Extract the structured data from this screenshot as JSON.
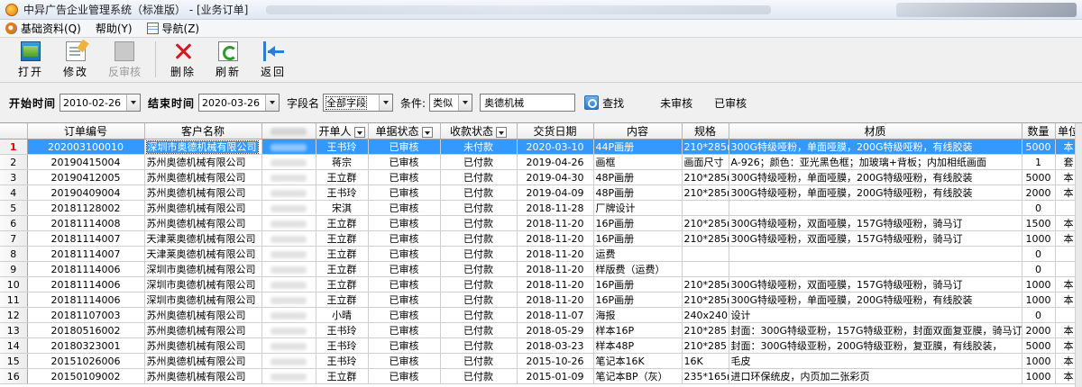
{
  "window": {
    "title": "中异广告企业管理系统（标准版） - [业务订单]"
  },
  "menu": [
    {
      "label": "基础资料(Q)",
      "icon": "base-data-icon"
    },
    {
      "label": "帮助(Y)",
      "icon": ""
    },
    {
      "label": "导航(Z)",
      "icon": "nav-icon"
    }
  ],
  "toolbar": {
    "open": "打开",
    "edit": "修改",
    "unreview": "反审核",
    "delete": "删除",
    "refresh": "刷新",
    "back": "返回"
  },
  "filter": {
    "start_label": "开始时间",
    "start_value": "2010-02-26",
    "end_label": "结束时间",
    "end_value": "2020-03-26",
    "field_label": "字段名",
    "field_value": "全部字段",
    "cond_label": "条件:",
    "cond_value": "类似",
    "keyword": "奥德机械",
    "search_label": "查找",
    "unreviewed_label": "未审核",
    "reviewed_label": "已审核"
  },
  "grid": {
    "columns": [
      "订单编号",
      "客户名称",
      "",
      "开单人",
      "单据状态",
      "收款状态",
      "交货日期",
      "内容",
      "规格",
      "材质",
      "数量",
      "单位"
    ],
    "selected_row": 0,
    "rows": [
      {
        "n": "1",
        "id": "202003100010",
        "cust": "深圳市奥德机械有限公司",
        "by": "王书玲",
        "status": "已审核",
        "pay": "未付款",
        "date": "2020-03-10",
        "content": "44P画册",
        "spec": "210*285mi",
        "mat": "300G特级哑粉，单面哑膜，200G特级哑粉，有线胶装",
        "qty": "5000",
        "unit": "本"
      },
      {
        "n": "2",
        "id": "20190415004",
        "cust": "苏州奥德机械有限公司",
        "by": "蒋宗",
        "status": "已审核",
        "pay": "已付款",
        "date": "2019-04-26",
        "content": "画框",
        "spec": "画面尺寸",
        "mat": "A-926；颜色：亚光黑色框；加玻璃+背板；内加相纸画面",
        "qty": "1",
        "unit": "套"
      },
      {
        "n": "3",
        "id": "20190412005",
        "cust": "苏州奥德机械有限公司",
        "by": "王立群",
        "status": "已审核",
        "pay": "已付款",
        "date": "2019-04-30",
        "content": "48P画册",
        "spec": "210*285mi",
        "mat": "300G特级哑粉，单面哑膜，200G特级哑粉，有线胶装",
        "qty": "5000",
        "unit": "本"
      },
      {
        "n": "4",
        "id": "20190409004",
        "cust": "苏州奥德机械有限公司",
        "by": "王书玲",
        "status": "已审核",
        "pay": "已付款",
        "date": "2019-04-09",
        "content": "48P画册",
        "spec": "210*285mi",
        "mat": "300G特级哑粉，单面哑膜，200G特级哑粉，有线胶装",
        "qty": "2000",
        "unit": "本"
      },
      {
        "n": "5",
        "id": "20181128002",
        "cust": "苏州奥德机械有限公司",
        "by": "宋淇",
        "status": "已审核",
        "pay": "已付款",
        "date": "2018-11-28",
        "content": "厂牌设计",
        "spec": "",
        "mat": "",
        "qty": "0",
        "unit": ""
      },
      {
        "n": "6",
        "id": "20181114008",
        "cust": "苏州奥德机械有限公司",
        "by": "王立群",
        "status": "已审核",
        "pay": "已付款",
        "date": "2018-11-20",
        "content": "16P画册",
        "spec": "210*285mi",
        "mat": "300G特级哑粉，双面哑膜，157G特级哑粉，骑马订",
        "qty": "1500",
        "unit": "本"
      },
      {
        "n": "7",
        "id": "20181114007",
        "cust": "天津莱奥德机械有限公司",
        "by": "王立群",
        "status": "已审核",
        "pay": "已付款",
        "date": "2018-11-20",
        "content": "16P画册",
        "spec": "210*285mi",
        "mat": "300G特级哑粉，双面哑膜，157G特级哑粉，骑马订",
        "qty": "1000",
        "unit": "本"
      },
      {
        "n": "8",
        "id": "20181114007",
        "cust": "天津莱奥德机械有限公司",
        "by": "王立群",
        "status": "已审核",
        "pay": "已付款",
        "date": "2018-11-20",
        "content": "运费",
        "spec": "",
        "mat": "",
        "qty": "0",
        "unit": ""
      },
      {
        "n": "9",
        "id": "20181114006",
        "cust": "深圳市奥德机械有限公司",
        "by": "王立群",
        "status": "已审核",
        "pay": "已付款",
        "date": "2018-11-20",
        "content": "样版费（运费）",
        "spec": "",
        "mat": "",
        "qty": "0",
        "unit": ""
      },
      {
        "n": "10",
        "id": "20181114006",
        "cust": "深圳市奥德机械有限公司",
        "by": "王立群",
        "status": "已审核",
        "pay": "已付款",
        "date": "2018-11-20",
        "content": "16P画册",
        "spec": "210*285mi",
        "mat": "300G特级哑粉，双面哑膜，157G特级哑粉，骑马订",
        "qty": "1000",
        "unit": "本"
      },
      {
        "n": "11",
        "id": "20181114006",
        "cust": "深圳市奥德机械有限公司",
        "by": "王立群",
        "status": "已审核",
        "pay": "已付款",
        "date": "2018-11-20",
        "content": "16P画册",
        "spec": "210*285mi",
        "mat": "300G特级哑粉，单面哑膜，200G特级哑粉，有线胶装",
        "qty": "1000",
        "unit": "本"
      },
      {
        "n": "12",
        "id": "20181107003",
        "cust": "苏州奥德机械有限公司",
        "by": "小晴",
        "status": "已审核",
        "pay": "已付款",
        "date": "2018-11-07",
        "content": "海报",
        "spec": "240x240m",
        "mat": "设计",
        "qty": "0",
        "unit": ""
      },
      {
        "n": "13",
        "id": "20180516002",
        "cust": "苏州奥德机械有限公司",
        "by": "王书玲",
        "status": "已审核",
        "pay": "已付款",
        "date": "2018-05-29",
        "content": "样本16P",
        "spec": "210*285",
        "mat": "封面：300G特级亚粉，157G特级亚粉，封面双面复亚膜，骑马订",
        "qty": "2000",
        "unit": "本"
      },
      {
        "n": "14",
        "id": "20180323001",
        "cust": "苏州奥德机械有限公司",
        "by": "王书玲",
        "status": "已审核",
        "pay": "已付款",
        "date": "2018-03-23",
        "content": "样本48P",
        "spec": "210*285",
        "mat": "封面：300G特级亚粉，200G特级亚粉，复亚膜，有线胶装，",
        "qty": "5000",
        "unit": "本"
      },
      {
        "n": "15",
        "id": "20151026006",
        "cust": "苏州奥德机械有限公司",
        "by": "王书玲",
        "status": "已审核",
        "pay": "已付款",
        "date": "2015-10-26",
        "content": "笔记本16K",
        "spec": "16K",
        "mat": "毛皮",
        "qty": "1000",
        "unit": "本"
      },
      {
        "n": "16",
        "id": "20150109002",
        "cust": "苏州奥德机械有限公司",
        "by": "王立群",
        "status": "已审核",
        "pay": "已付款",
        "date": "2015-01-09",
        "content": "笔记本BP（灰）",
        "spec": "235*165mi",
        "mat": "进口环保统皮，内页加二张彩页",
        "qty": "1000",
        "unit": "本"
      }
    ]
  },
  "colors": {
    "selection": "#3399ff",
    "unreviewed_row_number": "#e00000"
  }
}
